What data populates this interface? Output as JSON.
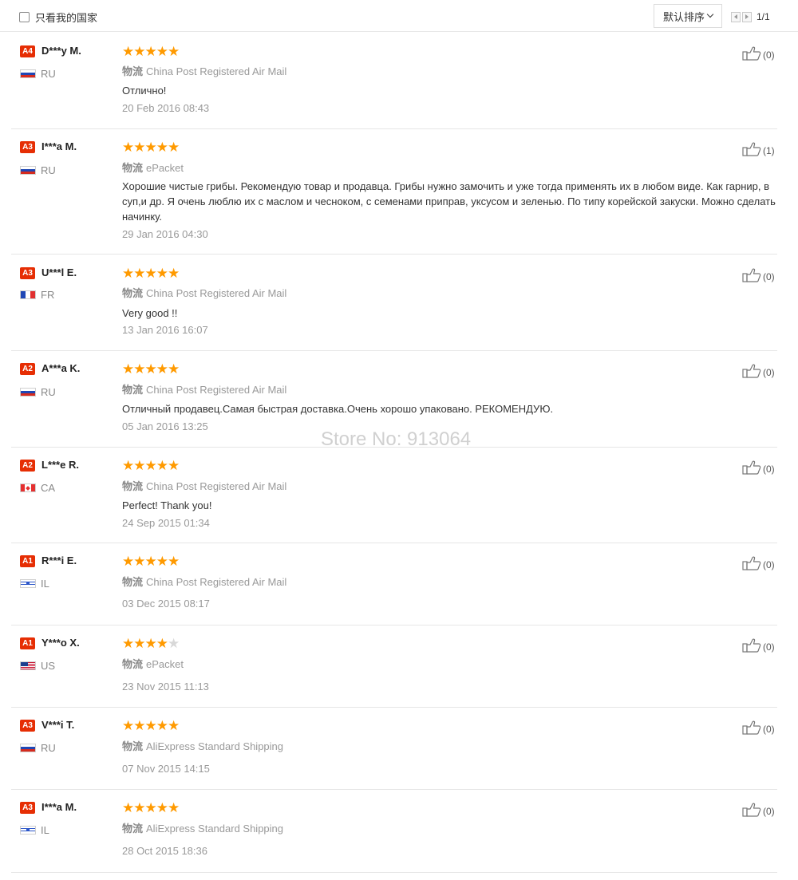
{
  "toolbar": {
    "filter_label": "只看我的国家",
    "sort_label": "默认排序",
    "pager_text": "1/1"
  },
  "watermark": "Store No: 913064",
  "shipping_key": "物流",
  "reviews": [
    {
      "level": "A4",
      "name": "D***y M.",
      "country": "RU",
      "stars": 5,
      "shipping": "China Post Registered Air Mail",
      "feedback": "Отлично!",
      "date": "20 Feb 2016 08:43",
      "helpful": "(0)"
    },
    {
      "level": "A3",
      "name": "I***a M.",
      "country": "RU",
      "stars": 5,
      "shipping": "ePacket",
      "feedback": "Хорошие чистые грибы. Рекомендую товар и продавца. Грибы нужно замочить и уже тогда применять их в любом виде. Как гарнир, в суп,и др. Я очень люблю их с маслом и чесноком, с семенами приправ, уксусом и зеленью. По типу корейской закуски. Можно сделать начинку.",
      "date": "29 Jan 2016 04:30",
      "helpful": "(1)"
    },
    {
      "level": "A3",
      "name": "U***l E.",
      "country": "FR",
      "stars": 5,
      "shipping": "China Post Registered Air Mail",
      "feedback": "Very good !!",
      "date": "13 Jan 2016 16:07",
      "helpful": "(0)"
    },
    {
      "level": "A2",
      "name": "A***a K.",
      "country": "RU",
      "stars": 5,
      "shipping": "China Post Registered Air Mail",
      "feedback": "Отличный продавец.Самая быстрая доставка.Очень хорошо упаковано. РЕКОМЕНДУЮ.",
      "date": "05 Jan 2016 13:25",
      "helpful": "(0)"
    },
    {
      "level": "A2",
      "name": "L***e R.",
      "country": "CA",
      "stars": 5,
      "shipping": "China Post Registered Air Mail",
      "feedback": "Perfect! Thank you!",
      "date": "24 Sep 2015 01:34",
      "helpful": "(0)"
    },
    {
      "level": "A1",
      "name": "R***i E.",
      "country": "IL",
      "stars": 5,
      "shipping": "China Post Registered Air Mail",
      "feedback": "",
      "date": "03 Dec 2015 08:17",
      "helpful": "(0)"
    },
    {
      "level": "A1",
      "name": "Y***o X.",
      "country": "US",
      "stars": 4,
      "shipping": "ePacket",
      "feedback": "",
      "date": "23 Nov 2015 11:13",
      "helpful": "(0)"
    },
    {
      "level": "A3",
      "name": "V***i T.",
      "country": "RU",
      "stars": 5,
      "shipping": "AliExpress Standard Shipping",
      "feedback": "",
      "date": "07 Nov 2015 14:15",
      "helpful": "(0)"
    },
    {
      "level": "A3",
      "name": "I***a M.",
      "country": "IL",
      "stars": 5,
      "shipping": "AliExpress Standard Shipping",
      "feedback": "",
      "date": "28 Oct 2015 18:36",
      "helpful": "(0)"
    }
  ]
}
